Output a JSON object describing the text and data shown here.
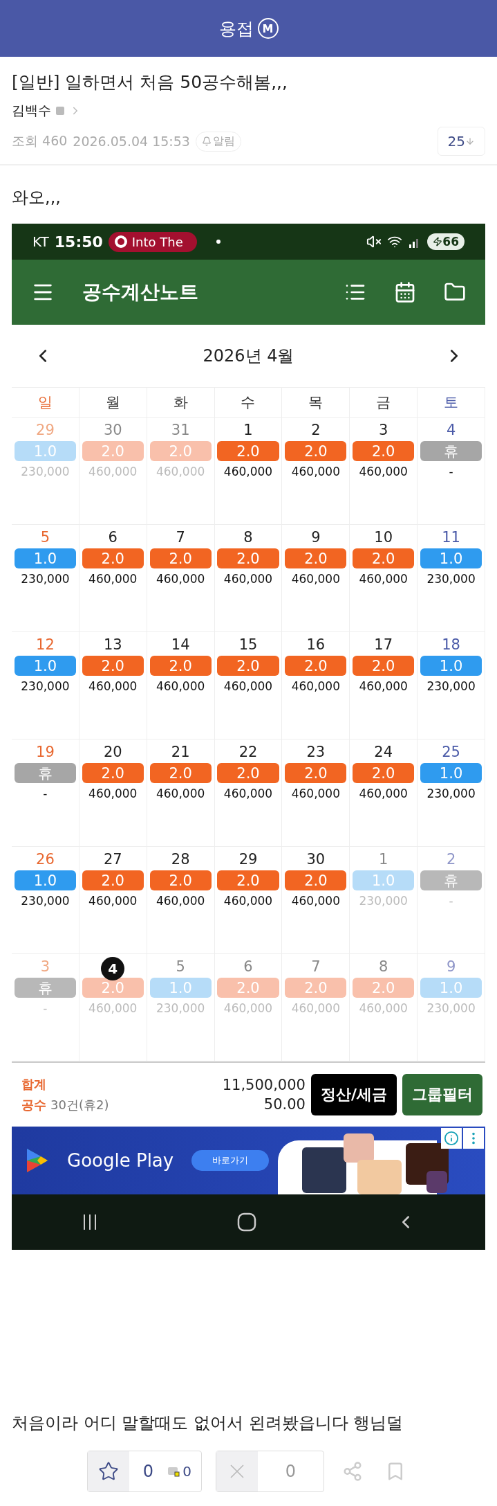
{
  "header": {
    "title": "용접",
    "badge": "M"
  },
  "post": {
    "title": "[일반] 일하면서 처음 50공수해봄,,,",
    "author": "김백수",
    "views": "조회 460",
    "date": "2026.05.04 15:53",
    "alarm": "알림",
    "comments": "25"
  },
  "body_top": "와오,,,",
  "phone": {
    "carrier": "KT",
    "time": "15:50",
    "media": "Into The",
    "battery": "66",
    "app_title": "공수계산노트",
    "month": "2026년 4월",
    "weekdays": [
      "일",
      "월",
      "화",
      "수",
      "목",
      "금",
      "토"
    ],
    "weeks": [
      [
        {
          "day": "29",
          "kind": "half",
          "label": "1.0",
          "amount": "230,000",
          "muted": true,
          "today": false
        },
        {
          "day": "30",
          "kind": "full",
          "label": "2.0",
          "amount": "460,000",
          "muted": true,
          "today": false
        },
        {
          "day": "31",
          "kind": "full",
          "label": "2.0",
          "amount": "460,000",
          "muted": true,
          "today": false
        },
        {
          "day": "1",
          "kind": "full",
          "label": "2.0",
          "amount": "460,000",
          "muted": false,
          "today": false
        },
        {
          "day": "2",
          "kind": "full",
          "label": "2.0",
          "amount": "460,000",
          "muted": false,
          "today": false
        },
        {
          "day": "3",
          "kind": "full",
          "label": "2.0",
          "amount": "460,000",
          "muted": false,
          "today": false
        },
        {
          "day": "4",
          "kind": "rest",
          "label": "휴",
          "amount": "-",
          "muted": false,
          "today": false
        }
      ],
      [
        {
          "day": "5",
          "kind": "half",
          "label": "1.0",
          "amount": "230,000",
          "muted": false,
          "today": false
        },
        {
          "day": "6",
          "kind": "full",
          "label": "2.0",
          "amount": "460,000",
          "muted": false,
          "today": false
        },
        {
          "day": "7",
          "kind": "full",
          "label": "2.0",
          "amount": "460,000",
          "muted": false,
          "today": false
        },
        {
          "day": "8",
          "kind": "full",
          "label": "2.0",
          "amount": "460,000",
          "muted": false,
          "today": false
        },
        {
          "day": "9",
          "kind": "full",
          "label": "2.0",
          "amount": "460,000",
          "muted": false,
          "today": false
        },
        {
          "day": "10",
          "kind": "full",
          "label": "2.0",
          "amount": "460,000",
          "muted": false,
          "today": false
        },
        {
          "day": "11",
          "kind": "half",
          "label": "1.0",
          "amount": "230,000",
          "muted": false,
          "today": false
        }
      ],
      [
        {
          "day": "12",
          "kind": "half",
          "label": "1.0",
          "amount": "230,000",
          "muted": false,
          "today": false
        },
        {
          "day": "13",
          "kind": "full",
          "label": "2.0",
          "amount": "460,000",
          "muted": false,
          "today": false
        },
        {
          "day": "14",
          "kind": "full",
          "label": "2.0",
          "amount": "460,000",
          "muted": false,
          "today": false
        },
        {
          "day": "15",
          "kind": "full",
          "label": "2.0",
          "amount": "460,000",
          "muted": false,
          "today": false
        },
        {
          "day": "16",
          "kind": "full",
          "label": "2.0",
          "amount": "460,000",
          "muted": false,
          "today": false
        },
        {
          "day": "17",
          "kind": "full",
          "label": "2.0",
          "amount": "460,000",
          "muted": false,
          "today": false
        },
        {
          "day": "18",
          "kind": "half",
          "label": "1.0",
          "amount": "230,000",
          "muted": false,
          "today": false
        }
      ],
      [
        {
          "day": "19",
          "kind": "rest",
          "label": "휴",
          "amount": "-",
          "muted": false,
          "today": false
        },
        {
          "day": "20",
          "kind": "full",
          "label": "2.0",
          "amount": "460,000",
          "muted": false,
          "today": false
        },
        {
          "day": "21",
          "kind": "full",
          "label": "2.0",
          "amount": "460,000",
          "muted": false,
          "today": false
        },
        {
          "day": "22",
          "kind": "full",
          "label": "2.0",
          "amount": "460,000",
          "muted": false,
          "today": false
        },
        {
          "day": "23",
          "kind": "full",
          "label": "2.0",
          "amount": "460,000",
          "muted": false,
          "today": false
        },
        {
          "day": "24",
          "kind": "full",
          "label": "2.0",
          "amount": "460,000",
          "muted": false,
          "today": false
        },
        {
          "day": "25",
          "kind": "half",
          "label": "1.0",
          "amount": "230,000",
          "muted": false,
          "today": false
        }
      ],
      [
        {
          "day": "26",
          "kind": "half",
          "label": "1.0",
          "amount": "230,000",
          "muted": false,
          "today": false
        },
        {
          "day": "27",
          "kind": "full",
          "label": "2.0",
          "amount": "460,000",
          "muted": false,
          "today": false
        },
        {
          "day": "28",
          "kind": "full",
          "label": "2.0",
          "amount": "460,000",
          "muted": false,
          "today": false
        },
        {
          "day": "29",
          "kind": "full",
          "label": "2.0",
          "amount": "460,000",
          "muted": false,
          "today": false
        },
        {
          "day": "30",
          "kind": "full",
          "label": "2.0",
          "amount": "460,000",
          "muted": false,
          "today": false
        },
        {
          "day": "1",
          "kind": "half",
          "label": "1.0",
          "amount": "230,000",
          "muted": true,
          "today": false
        },
        {
          "day": "2",
          "kind": "rest",
          "label": "휴",
          "amount": "-",
          "muted": true,
          "today": false
        }
      ],
      [
        {
          "day": "3",
          "kind": "rest",
          "label": "휴",
          "amount": "-",
          "muted": true,
          "today": false
        },
        {
          "day": "4",
          "kind": "full",
          "label": "2.0",
          "amount": "460,000",
          "muted": true,
          "today": true
        },
        {
          "day": "5",
          "kind": "half",
          "label": "1.0",
          "amount": "230,000",
          "muted": true,
          "today": false
        },
        {
          "day": "6",
          "kind": "full",
          "label": "2.0",
          "amount": "460,000",
          "muted": true,
          "today": false
        },
        {
          "day": "7",
          "kind": "full",
          "label": "2.0",
          "amount": "460,000",
          "muted": true,
          "today": false
        },
        {
          "day": "8",
          "kind": "full",
          "label": "2.0",
          "amount": "460,000",
          "muted": true,
          "today": false
        },
        {
          "day": "9",
          "kind": "half",
          "label": "1.0",
          "amount": "230,000",
          "muted": true,
          "today": false
        }
      ]
    ],
    "summary": {
      "total_label": "합계",
      "total": "11,500,000",
      "count_label": "공수",
      "count": "30건(휴2)",
      "count_value": "50.00",
      "buttons": [
        "정산/세금",
        "그룹필터"
      ]
    },
    "ad": {
      "brand": "Google Play",
      "button": "바로가기"
    }
  },
  "body_bottom": "처음이라 어디 말할때도 없어서 왼려봤읍니다 행님덜",
  "reactions": {
    "likes": "0",
    "gifts": "0",
    "dislikes": "0"
  }
}
